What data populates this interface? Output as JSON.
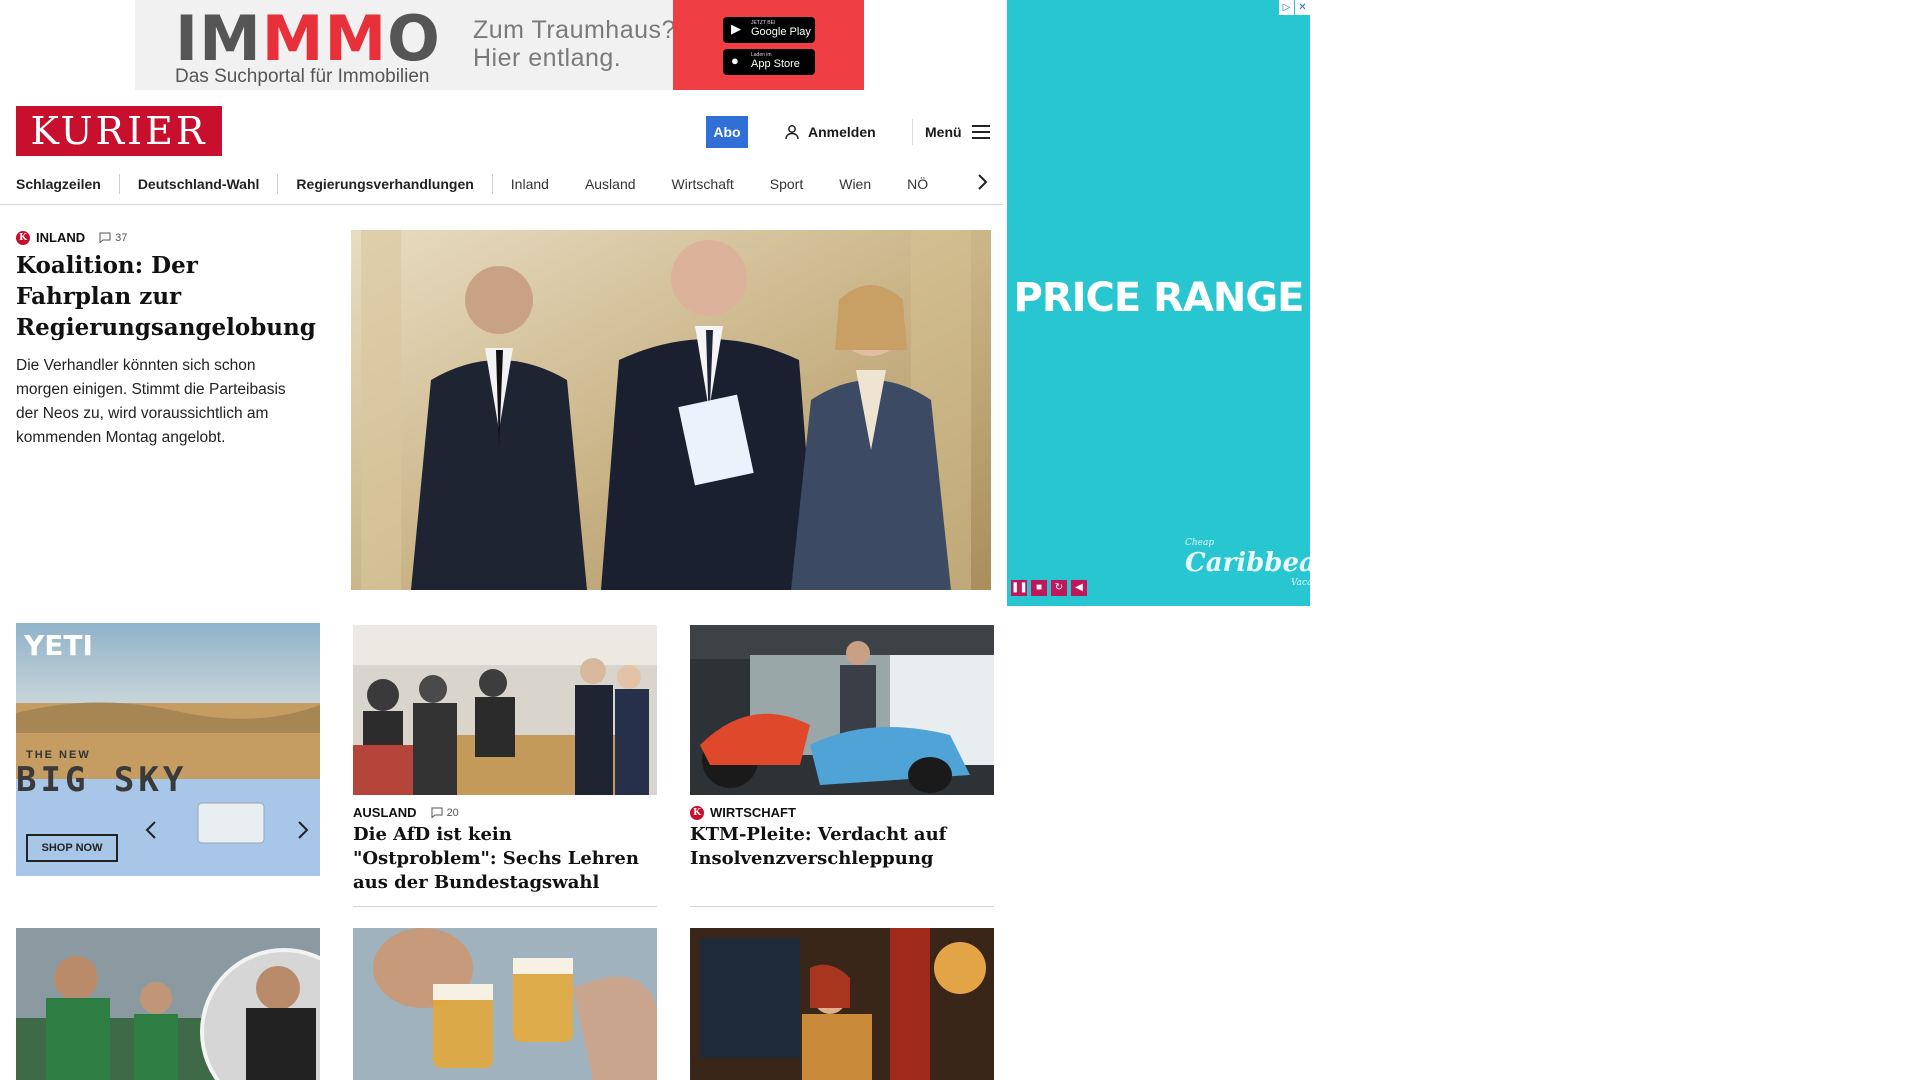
{
  "top_ad": {
    "brand_pre": "IM",
    "brand_mid": "MM",
    "brand_post": "O",
    "subline": "Das Suchportal für Immobilien",
    "claim_line1": "Zum Traumhaus?",
    "claim_line2": "Hier entlang.",
    "google_small": "JETZT BEI",
    "google_label": "Google Play",
    "apple_small": "Laden im",
    "apple_label": "App Store"
  },
  "header": {
    "logo": "KURIER",
    "abo": "Abo",
    "login": "Anmelden",
    "menu": "Menü"
  },
  "nav": {
    "items": [
      "Schlagzeilen",
      "Deutschland-Wahl",
      "Regierungsverhandlungen",
      "Inland",
      "Ausland",
      "Wirtschaft",
      "Sport",
      "Wien",
      "NÖ"
    ]
  },
  "lead": {
    "category": "Inland",
    "comments": "37",
    "title": "Koalition: Der Fahrplan zur Regierungsangelobung",
    "teaser": "Die Verhandler könnten sich schon morgen einigen. Stimmt die Parteibasis der Neos zu, wird voraussichtlich am kommenden Montag angelobt."
  },
  "side_ad": {
    "headline": "PRICE RANGE",
    "brand_small_top": "Cheap",
    "brand": "Caribbean",
    "brand_small_bottom": "Vacations"
  },
  "yeti_ad": {
    "brand": "YETI",
    "tag_small": "THE NEW",
    "tag_big": "BIG SKY",
    "cta": "SHOP NOW"
  },
  "cards": [
    {
      "category": "Ausland",
      "comments": "20",
      "title": "Die AfD ist kein \"Ostproblem\": Sechs Lehren aus der Bundestagswahl"
    },
    {
      "category": "Wirtschaft",
      "title": "KTM-Pleite: Verdacht auf Insolvenzverschleppung"
    }
  ],
  "colors": {
    "brand_red": "#c8102e",
    "abo_blue": "#2f6fd6",
    "ad_teal": "#27c6d1"
  }
}
